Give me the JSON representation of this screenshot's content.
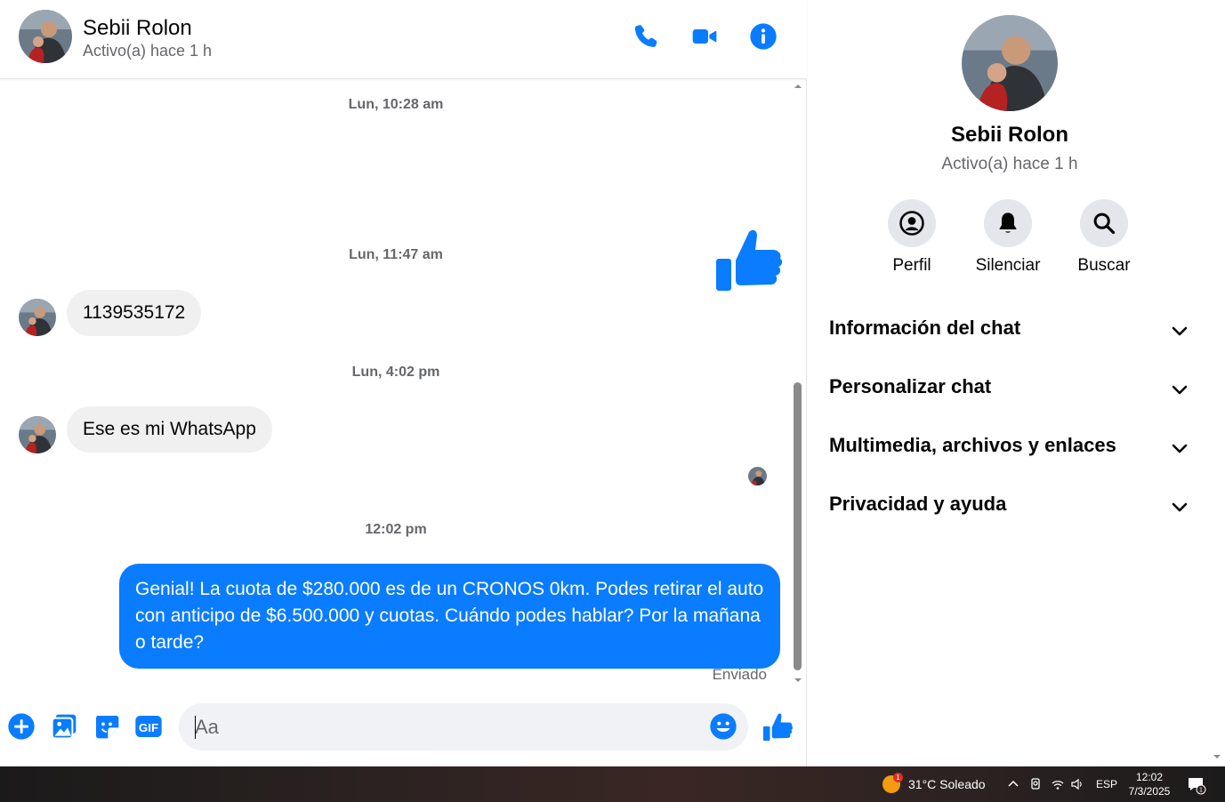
{
  "contact": {
    "name": "Sebii Rolon",
    "status": "Activo(a) hace 1 h"
  },
  "header": {
    "call_icon": "phone-icon",
    "video_icon": "video-camera-icon",
    "info_icon": "info-icon"
  },
  "messages": {
    "timestamps": [
      "Lun, 10:28 am",
      "Lun, 11:47 am",
      "Lun, 4:02 pm",
      "12:02 pm"
    ],
    "incoming": [
      "1139535172",
      "Ese es mi WhatsApp"
    ],
    "outgoing": "Genial! La cuota de $280.000 es de un CRONOS 0km. Podes retirar el auto con anticipo de $6.500.000 y cuotas. Cuándo podes hablar? Por la mañana o tarde?",
    "sent_label": "Enviado"
  },
  "composer": {
    "placeholder": "Aa"
  },
  "side": {
    "actions": [
      "Perfil",
      "Silenciar",
      "Buscar"
    ],
    "sections": [
      "Información del chat",
      "Personalizar chat",
      "Multimedia, archivos y enlaces",
      "Privacidad y ayuda"
    ]
  },
  "taskbar": {
    "weather": "31°C  Soleado",
    "weather_badge": "1",
    "language": "ESP",
    "time": "12:02",
    "date": "7/3/2025",
    "notification_count": "1"
  },
  "colors": {
    "accent": "#0a7cff",
    "incoming_bubble": "#f0f0f0",
    "muted_text": "#65676b"
  }
}
